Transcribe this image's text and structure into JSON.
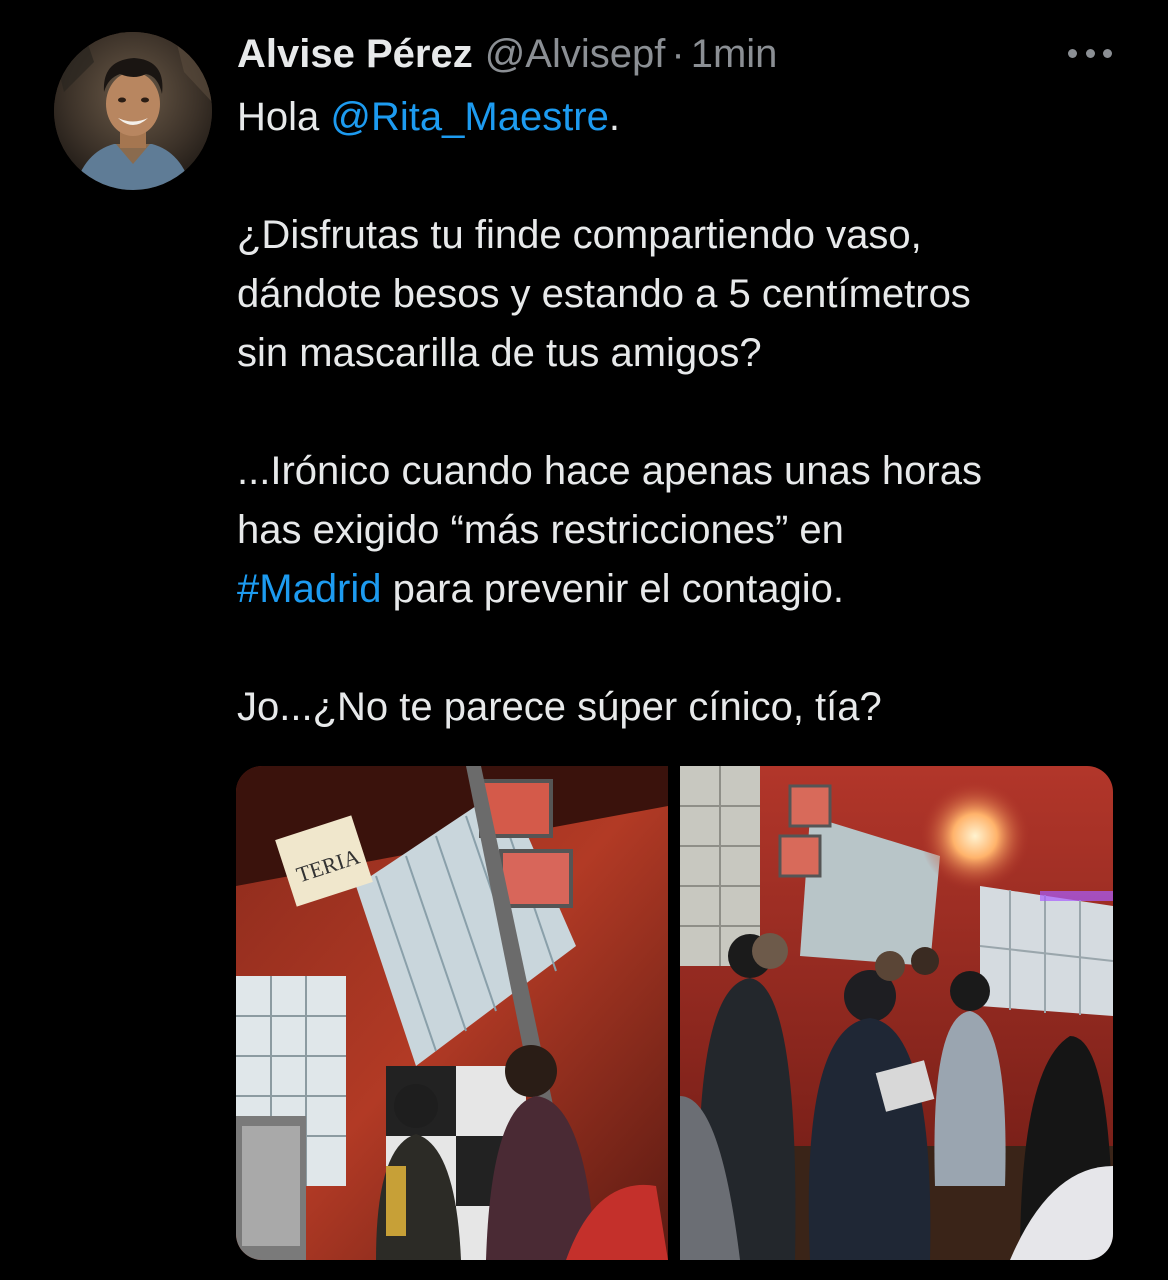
{
  "tweet": {
    "author": {
      "display_name": "Alvise Pérez",
      "handle": "@Alvisepf",
      "separator": "·",
      "time": "1min"
    },
    "more_icon": "more-horizontal-icon",
    "body": {
      "line1_prefix": "Hola ",
      "line1_mention": "@Rita_Maestre",
      "line1_suffix": ".",
      "para2_line1": "¿Disfrutas tu finde compartiendo vaso,",
      "para2_line2": "dándote besos y estando a 5 centímetros",
      "para2_line3": "sin mascarilla de tus amigos?",
      "para3_line1": "...Irónico cuando hace apenas unas horas",
      "para3_line2": "has exigido “más restricciones” en",
      "para3_hashtag": "#Madrid",
      "para3_line3_suffix": " para prevenir el contagio.",
      "para4_line1": "Jo...¿No te parece súper cínico, tía?"
    },
    "photo_1_sign": "TERIA"
  },
  "colors": {
    "background": "#000000",
    "text": "#e7e9ea",
    "secondary": "#8b8f94",
    "link": "#1d9bf0"
  }
}
